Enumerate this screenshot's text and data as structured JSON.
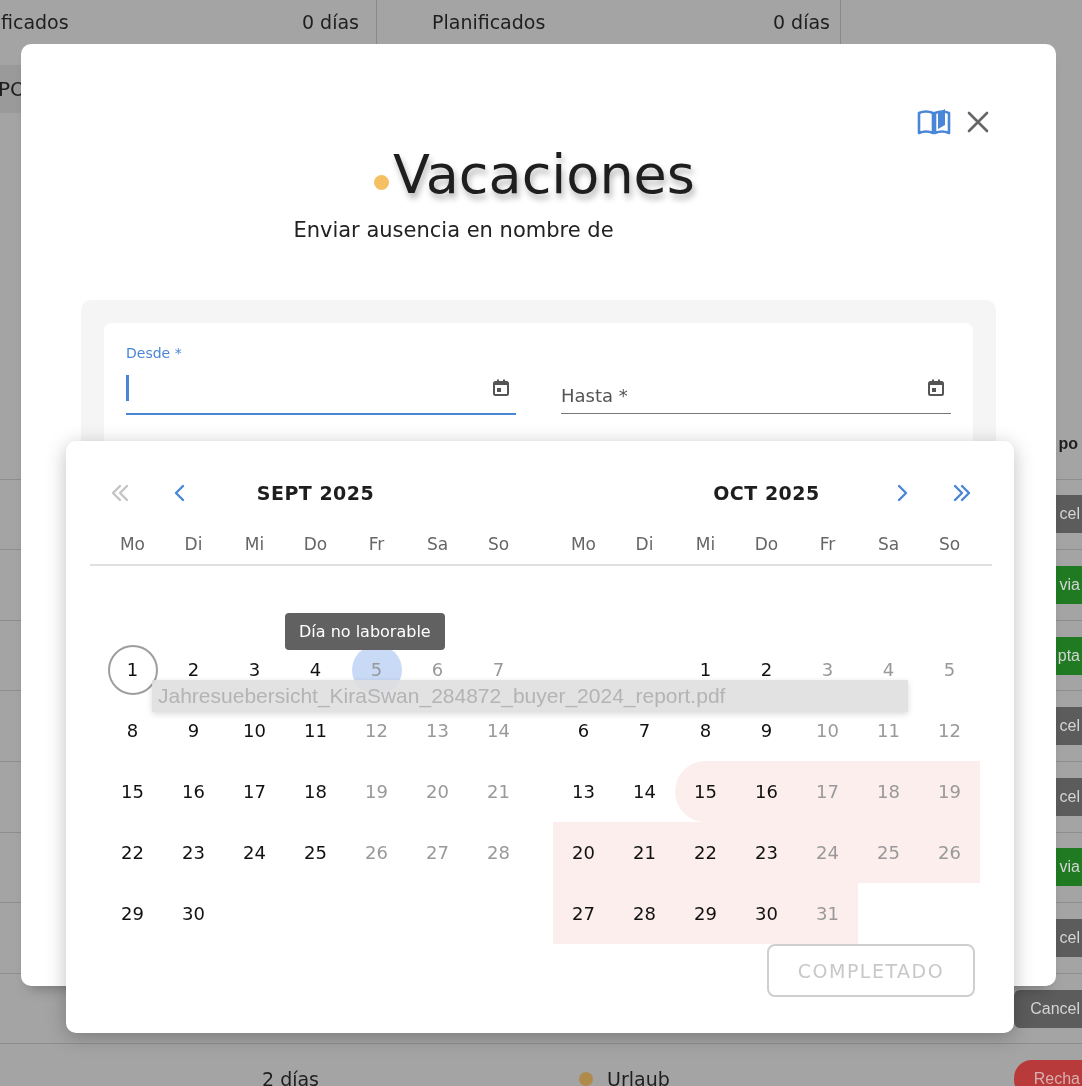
{
  "background": {
    "header_cells": [
      {
        "label": "ficados",
        "value": "0 días"
      },
      {
        "label": "Planificados",
        "value": "0 días"
      }
    ],
    "side_tab": "PO",
    "status_heading": "po",
    "status_badges": [
      {
        "label": "cel",
        "color": "#5c5c5c"
      },
      {
        "label": "via",
        "color": "#1f7a22"
      },
      {
        "label": "pta",
        "color": "#1f7a22"
      },
      {
        "label": "cel",
        "color": "#5c5c5c"
      },
      {
        "label": "cel",
        "color": "#5c5c5c"
      },
      {
        "label": "via",
        "color": "#1f7a22"
      },
      {
        "label": "cel",
        "color": "#5c5c5c"
      },
      {
        "label": "Cancel",
        "color": "#5c5c5c"
      }
    ],
    "bottom_row": {
      "duration": "2 días",
      "type": "Urlaub",
      "status": {
        "label": "Recha",
        "color": "#b83a3a"
      }
    }
  },
  "dialog": {
    "title": "Vacaciones",
    "subtitle": "Enviar ausencia en nombre de",
    "fields": [
      {
        "label": "Desde *",
        "focused": true
      },
      {
        "label": "Hasta *",
        "focused": false
      }
    ]
  },
  "date_picker": {
    "months": [
      {
        "title": "SEPT 2025",
        "nav": [
          {
            "kind": "prev-year",
            "disabled": true
          },
          {
            "kind": "prev-month",
            "disabled": false
          }
        ],
        "weekdays": [
          "Mo",
          "Di",
          "Mi",
          "Do",
          "Fr",
          "Sa",
          "So"
        ],
        "days": [
          {
            "kind": "day",
            "label": "1",
            "muted": false,
            "today": true,
            "hovered": false,
            "in_range": false
          },
          {
            "kind": "day",
            "label": "2",
            "muted": false,
            "today": false,
            "hovered": false,
            "in_range": false
          },
          {
            "kind": "day",
            "label": "3",
            "muted": false,
            "today": false,
            "hovered": false,
            "in_range": false
          },
          {
            "kind": "day",
            "label": "4",
            "muted": false,
            "today": false,
            "hovered": false,
            "in_range": false
          },
          {
            "kind": "day",
            "label": "5",
            "muted": true,
            "today": false,
            "hovered": true,
            "in_range": false
          },
          {
            "kind": "day",
            "label": "6",
            "muted": true,
            "today": false,
            "hovered": false,
            "in_range": false
          },
          {
            "kind": "day",
            "label": "7",
            "muted": true,
            "today": false,
            "hovered": false,
            "in_range": false
          },
          {
            "kind": "day",
            "label": "8",
            "muted": false,
            "today": false,
            "hovered": false,
            "in_range": false
          },
          {
            "kind": "day",
            "label": "9",
            "muted": false,
            "today": false,
            "hovered": false,
            "in_range": false
          },
          {
            "kind": "day",
            "label": "10",
            "muted": false,
            "today": false,
            "hovered": false,
            "in_range": false
          },
          {
            "kind": "day",
            "label": "11",
            "muted": false,
            "today": false,
            "hovered": false,
            "in_range": false
          },
          {
            "kind": "day",
            "label": "12",
            "muted": true,
            "today": false,
            "hovered": false,
            "in_range": false
          },
          {
            "kind": "day",
            "label": "13",
            "muted": true,
            "today": false,
            "hovered": false,
            "in_range": false
          },
          {
            "kind": "day",
            "label": "14",
            "muted": true,
            "today": false,
            "hovered": false,
            "in_range": false
          },
          {
            "kind": "day",
            "label": "15",
            "muted": false,
            "today": false,
            "hovered": false,
            "in_range": false
          },
          {
            "kind": "day",
            "label": "16",
            "muted": false,
            "today": false,
            "hovered": false,
            "in_range": false
          },
          {
            "kind": "day",
            "label": "17",
            "muted": false,
            "today": false,
            "hovered": false,
            "in_range": false
          },
          {
            "kind": "day",
            "label": "18",
            "muted": false,
            "today": false,
            "hovered": false,
            "in_range": false
          },
          {
            "kind": "day",
            "label": "19",
            "muted": true,
            "today": false,
            "hovered": false,
            "in_range": false
          },
          {
            "kind": "day",
            "label": "20",
            "muted": true,
            "today": false,
            "hovered": false,
            "in_range": false
          },
          {
            "kind": "day",
            "label": "21",
            "muted": true,
            "today": false,
            "hovered": false,
            "in_range": false
          },
          {
            "kind": "day",
            "label": "22",
            "muted": false,
            "today": false,
            "hovered": false,
            "in_range": false
          },
          {
            "kind": "day",
            "label": "23",
            "muted": false,
            "today": false,
            "hovered": false,
            "in_range": false
          },
          {
            "kind": "day",
            "label": "24",
            "muted": false,
            "today": false,
            "hovered": false,
            "in_range": false
          },
          {
            "kind": "day",
            "label": "25",
            "muted": false,
            "today": false,
            "hovered": false,
            "in_range": false
          },
          {
            "kind": "day",
            "label": "26",
            "muted": true,
            "today": false,
            "hovered": false,
            "in_range": false
          },
          {
            "kind": "day",
            "label": "27",
            "muted": true,
            "today": false,
            "hovered": false,
            "in_range": false
          },
          {
            "kind": "day",
            "label": "28",
            "muted": true,
            "today": false,
            "hovered": false,
            "in_range": false
          },
          {
            "kind": "day",
            "label": "29",
            "muted": false,
            "today": false,
            "hovered": false,
            "in_range": false
          },
          {
            "kind": "day",
            "label": "30",
            "muted": false,
            "today": false,
            "hovered": false,
            "in_range": false
          }
        ]
      },
      {
        "title": "OCT 2025",
        "nav": [
          {
            "kind": "next-month",
            "disabled": false
          },
          {
            "kind": "next-year",
            "disabled": false
          }
        ],
        "weekdays": [
          "Mo",
          "Di",
          "Mi",
          "Do",
          "Fr",
          "Sa",
          "So"
        ],
        "days": [
          {
            "kind": "blank"
          },
          {
            "kind": "blank"
          },
          {
            "kind": "day",
            "label": "1",
            "muted": false,
            "today": false,
            "hovered": false,
            "in_range": false
          },
          {
            "kind": "day",
            "label": "2",
            "muted": false,
            "today": false,
            "hovered": false,
            "in_range": false
          },
          {
            "kind": "day",
            "label": "3",
            "muted": true,
            "today": false,
            "hovered": false,
            "in_range": false
          },
          {
            "kind": "day",
            "label": "4",
            "muted": true,
            "today": false,
            "hovered": false,
            "in_range": false
          },
          {
            "kind": "day",
            "label": "5",
            "muted": true,
            "today": false,
            "hovered": false,
            "in_range": false
          },
          {
            "kind": "day",
            "label": "6",
            "muted": false,
            "today": false,
            "hovered": false,
            "in_range": false
          },
          {
            "kind": "day",
            "label": "7",
            "muted": false,
            "today": false,
            "hovered": false,
            "in_range": false
          },
          {
            "kind": "day",
            "label": "8",
            "muted": false,
            "today": false,
            "hovered": false,
            "in_range": false
          },
          {
            "kind": "day",
            "label": "9",
            "muted": false,
            "today": false,
            "hovered": false,
            "in_range": false
          },
          {
            "kind": "day",
            "label": "10",
            "muted": true,
            "today": false,
            "hovered": false,
            "in_range": false
          },
          {
            "kind": "day",
            "label": "11",
            "muted": true,
            "today": false,
            "hovered": false,
            "in_range": false
          },
          {
            "kind": "day",
            "label": "12",
            "muted": true,
            "today": false,
            "hovered": false,
            "in_range": false
          },
          {
            "kind": "day",
            "label": "13",
            "muted": false,
            "today": false,
            "hovered": false,
            "in_range": false
          },
          {
            "kind": "day",
            "label": "14",
            "muted": false,
            "today": false,
            "hovered": false,
            "in_range": false
          },
          {
            "kind": "day",
            "label": "15",
            "muted": false,
            "today": false,
            "hovered": false,
            "in_range": true
          },
          {
            "kind": "day",
            "label": "16",
            "muted": false,
            "today": false,
            "hovered": false,
            "in_range": true
          },
          {
            "kind": "day",
            "label": "17",
            "muted": true,
            "today": false,
            "hovered": false,
            "in_range": true
          },
          {
            "kind": "day",
            "label": "18",
            "muted": true,
            "today": false,
            "hovered": false,
            "in_range": true
          },
          {
            "kind": "day",
            "label": "19",
            "muted": true,
            "today": false,
            "hovered": false,
            "in_range": true
          },
          {
            "kind": "day",
            "label": "20",
            "muted": false,
            "today": false,
            "hovered": false,
            "in_range": true
          },
          {
            "kind": "day",
            "label": "21",
            "muted": false,
            "today": false,
            "hovered": false,
            "in_range": true
          },
          {
            "kind": "day",
            "label": "22",
            "muted": false,
            "today": false,
            "hovered": false,
            "in_range": true
          },
          {
            "kind": "day",
            "label": "23",
            "muted": false,
            "today": false,
            "hovered": false,
            "in_range": true
          },
          {
            "kind": "day",
            "label": "24",
            "muted": true,
            "today": false,
            "hovered": false,
            "in_range": true
          },
          {
            "kind": "day",
            "label": "25",
            "muted": true,
            "today": false,
            "hovered": false,
            "in_range": true
          },
          {
            "kind": "day",
            "label": "26",
            "muted": true,
            "today": false,
            "hovered": false,
            "in_range": true
          },
          {
            "kind": "day",
            "label": "27",
            "muted": false,
            "today": false,
            "hovered": false,
            "in_range": true
          },
          {
            "kind": "day",
            "label": "28",
            "muted": false,
            "today": false,
            "hovered": false,
            "in_range": true
          },
          {
            "kind": "day",
            "label": "29",
            "muted": false,
            "today": false,
            "hovered": false,
            "in_range": true
          },
          {
            "kind": "day",
            "label": "30",
            "muted": false,
            "today": false,
            "hovered": false,
            "in_range": true
          },
          {
            "kind": "day",
            "label": "31",
            "muted": true,
            "today": false,
            "hovered": false,
            "in_range": true
          }
        ]
      }
    ],
    "tooltip": "Día no laborable",
    "drag_label": "Jahresuebersicht_KiraSwan_284872_buyer_2024_report.pdf",
    "done_button": {
      "label": "COMPLETADO",
      "disabled": true
    }
  }
}
